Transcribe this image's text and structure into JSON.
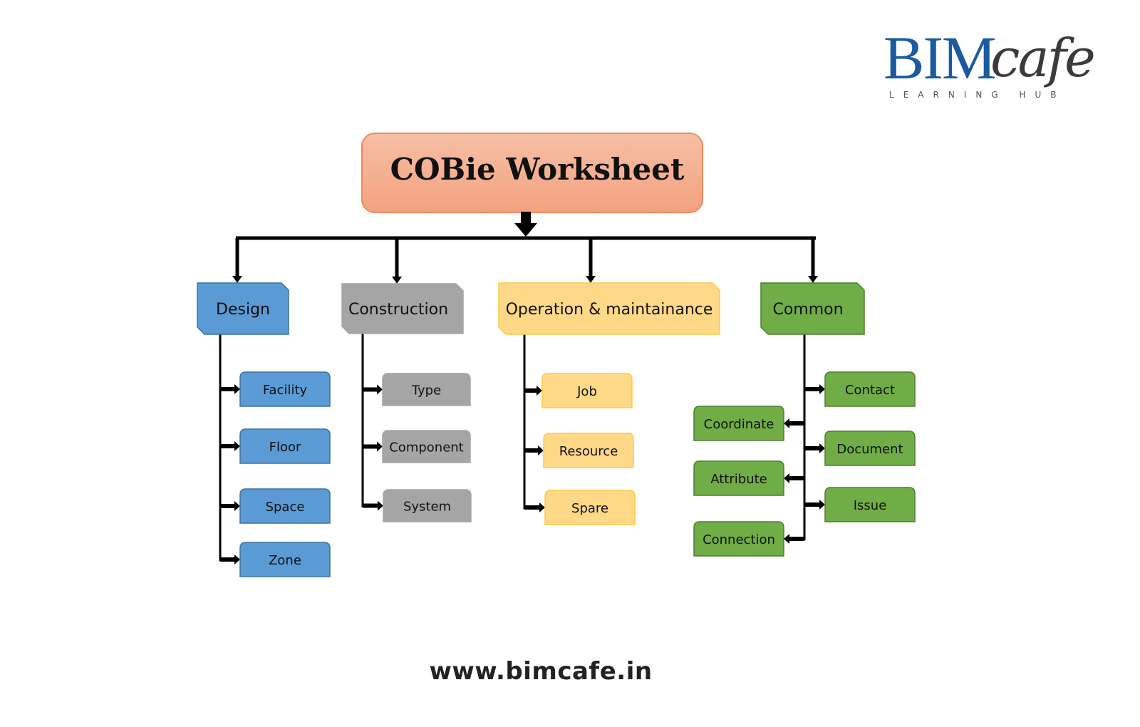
{
  "logo": {
    "brand_primary": "BIM",
    "brand_secondary": "cafe",
    "tagline": "LEARNING HUB"
  },
  "website": "www.bimcafe.in",
  "root": {
    "label": "COBie Worksheet",
    "color_top": "#f6bfa5",
    "color_bottom": "#f3a280",
    "border": "#f08a5d"
  },
  "categories": [
    {
      "id": "design",
      "label": "Design",
      "fill": "#5b9bd5",
      "border": "#41719c",
      "children": [
        "Facility",
        "Floor",
        "Space",
        "Zone"
      ]
    },
    {
      "id": "construction",
      "label": "Construction",
      "fill": "#a5a5a5",
      "border": "#a5a5a5",
      "children": [
        "Type",
        "Component",
        "System"
      ]
    },
    {
      "id": "operation",
      "label": "Operation & maintainance",
      "fill": "#ffd888",
      "border": "#ffc845",
      "children": [
        "Job",
        "Resource",
        "Spare"
      ]
    },
    {
      "id": "common",
      "label": "Common",
      "fill": "#70ad47",
      "border": "#507e32",
      "children_right": [
        "Contact",
        "Document",
        "Issue"
      ],
      "children_left": [
        "Coordinate",
        "Attribute",
        "Connection"
      ]
    }
  ]
}
